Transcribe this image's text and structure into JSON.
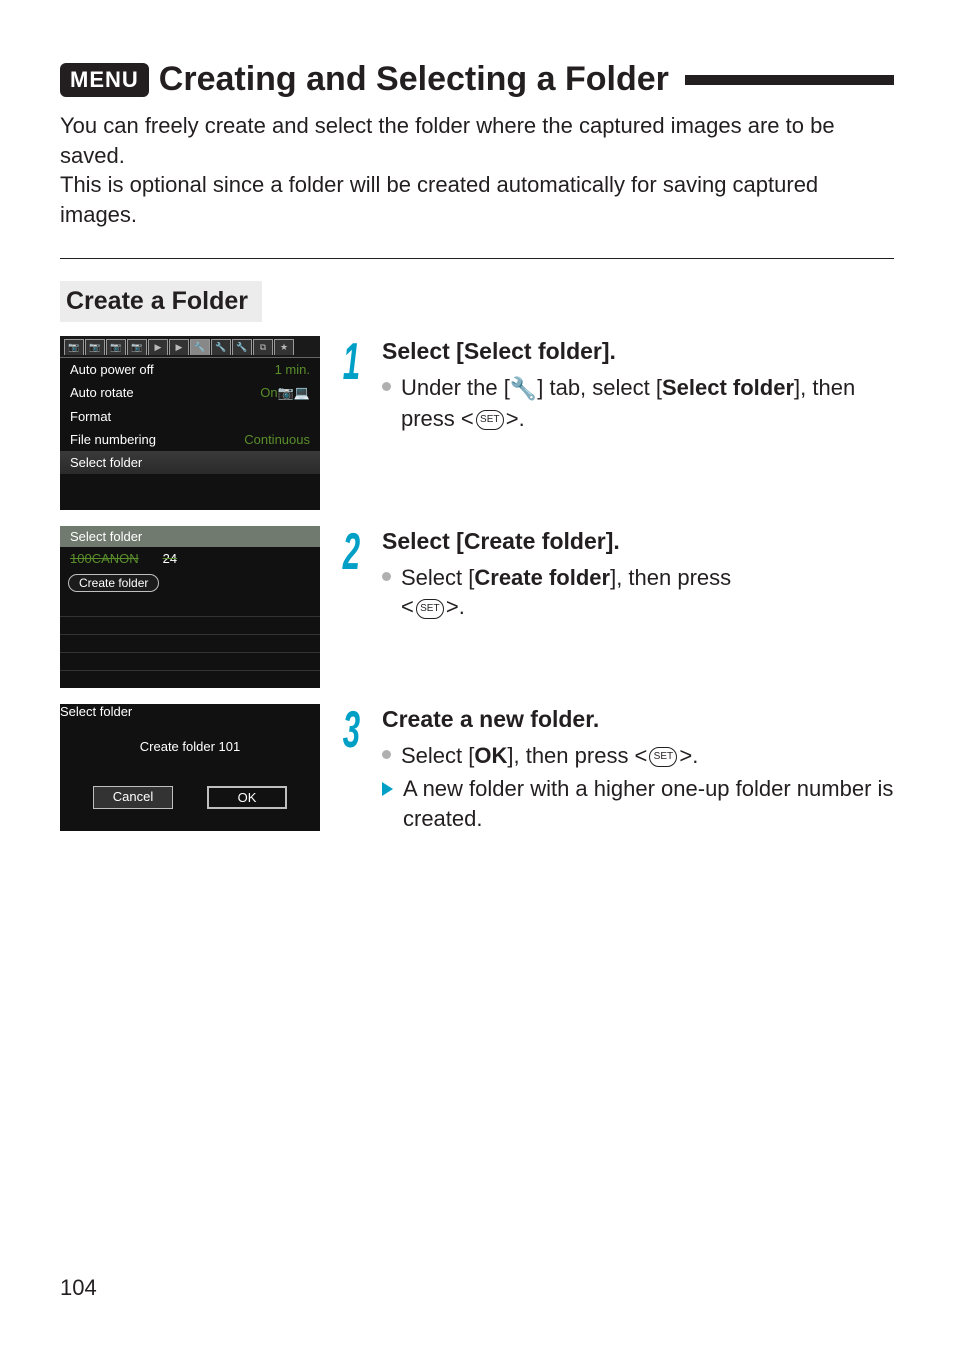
{
  "heading": {
    "badge": "MENU",
    "title": "Creating and Selecting a Folder"
  },
  "intro": "You can freely create and select the folder where the captured images are to be saved.\nThis is optional since a folder will be created automatically for saving captured images.",
  "section_title": "Create a Folder",
  "screens": {
    "menu1": {
      "rows": [
        {
          "label": "Auto power off",
          "value": "1 min."
        },
        {
          "label": "Auto rotate",
          "value": "On📷💻"
        },
        {
          "label": "Format",
          "value": ""
        },
        {
          "label": "File numbering",
          "value": "Continuous"
        },
        {
          "label": "Select folder",
          "value": "",
          "highlight": true
        }
      ]
    },
    "menu2": {
      "header": "Select folder",
      "folder_name": "100CANON",
      "folder_count": "24",
      "create_label": "Create folder"
    },
    "dialog": {
      "header": "Select folder",
      "message": "Create folder 101",
      "cancel": "Cancel",
      "ok": "OK"
    }
  },
  "steps": [
    {
      "num": "1",
      "title": "Select [Select folder].",
      "body_prefix": "Under the [",
      "body_middle": "] tab, select [",
      "body_bold": "Select folder",
      "body_suffix": "], then press <",
      "body_end": ">.",
      "wrench": "🔧",
      "set": "SET"
    },
    {
      "num": "2",
      "title": "Select [Create folder].",
      "line1_prefix": "Select [",
      "line1_bold": "Create folder",
      "line1_suffix": "], then press",
      "line2_prefix": "<",
      "line2_end": ">.",
      "set": "SET"
    },
    {
      "num": "3",
      "title": "Create a new folder.",
      "line1_prefix": "Select [",
      "line1_bold": "OK",
      "line1_suffix": "], then press <",
      "line1_end": ">.",
      "set": "SET",
      "tri_text": "A new folder with a higher one-up folder number is created."
    }
  ],
  "page_number": "104"
}
